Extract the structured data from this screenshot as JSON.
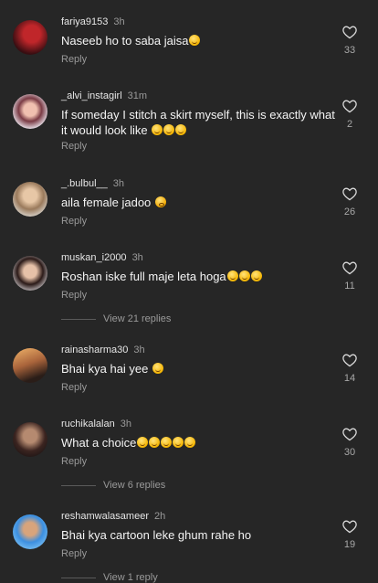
{
  "colors": {
    "background": "#262626",
    "text": "#f2f2f2",
    "muted": "#9a9a9a"
  },
  "comments": [
    {
      "username": "fariya9153",
      "time": "3h",
      "text": "Naseeb ho to saba jaisa",
      "emojis": [
        "grinning-sweat"
      ],
      "reply": "Reply",
      "likes": "33",
      "avatar": "avatar-red-scarf"
    },
    {
      "username": "_alvi_instagirl",
      "time": "31m",
      "text": "If someday I stitch a skirt myself, this is exactly what it would look like",
      "emojis": [
        "grinning-sweat",
        "winking-tongue",
        "grinning-sweat"
      ],
      "reply": "Reply",
      "likes": "2",
      "avatar": "avatar-woman-pink"
    },
    {
      "username": "_.bulbul__",
      "time": "3h",
      "text": "aila female jadoo",
      "emojis": [
        "flushed"
      ],
      "reply": "Reply",
      "likes": "26",
      "avatar": "avatar-woman-light"
    },
    {
      "username": "muskan_i2000",
      "time": "3h",
      "text": "Roshan iske full maje leta hoga",
      "emojis": [
        "grinning-sweat",
        "grinning-sweat",
        "grinning-sweat"
      ],
      "reply": "Reply",
      "likes": "11",
      "avatar": "avatar-woman-dark-hair"
    },
    {
      "username": "rainasharma30",
      "time": "3h",
      "text": "Bhai kya hai yee",
      "emojis": [
        "grinning-sweat"
      ],
      "reply": "Reply",
      "likes": "14",
      "avatar": "avatar-sunset-person"
    },
    {
      "username": "ruchikalalan",
      "time": "3h",
      "text": "What a choice",
      "emojis": [
        "grinning-sweat",
        "grinning-sweat",
        "grinning-sweat",
        "grinning-sweat",
        "grinning-sweat"
      ],
      "reply": "Reply",
      "likes": "30",
      "avatar": "avatar-woman-dark"
    },
    {
      "username": "reshamwalasameer",
      "time": "2h",
      "text": "Bhai kya cartoon leke ghum rahe ho",
      "emojis": [],
      "reply": "Reply",
      "likes": "19",
      "avatar": "avatar-man-blue"
    }
  ],
  "view_replies": [
    "View 21 replies",
    "View 6 replies",
    "View 1 reply"
  ]
}
